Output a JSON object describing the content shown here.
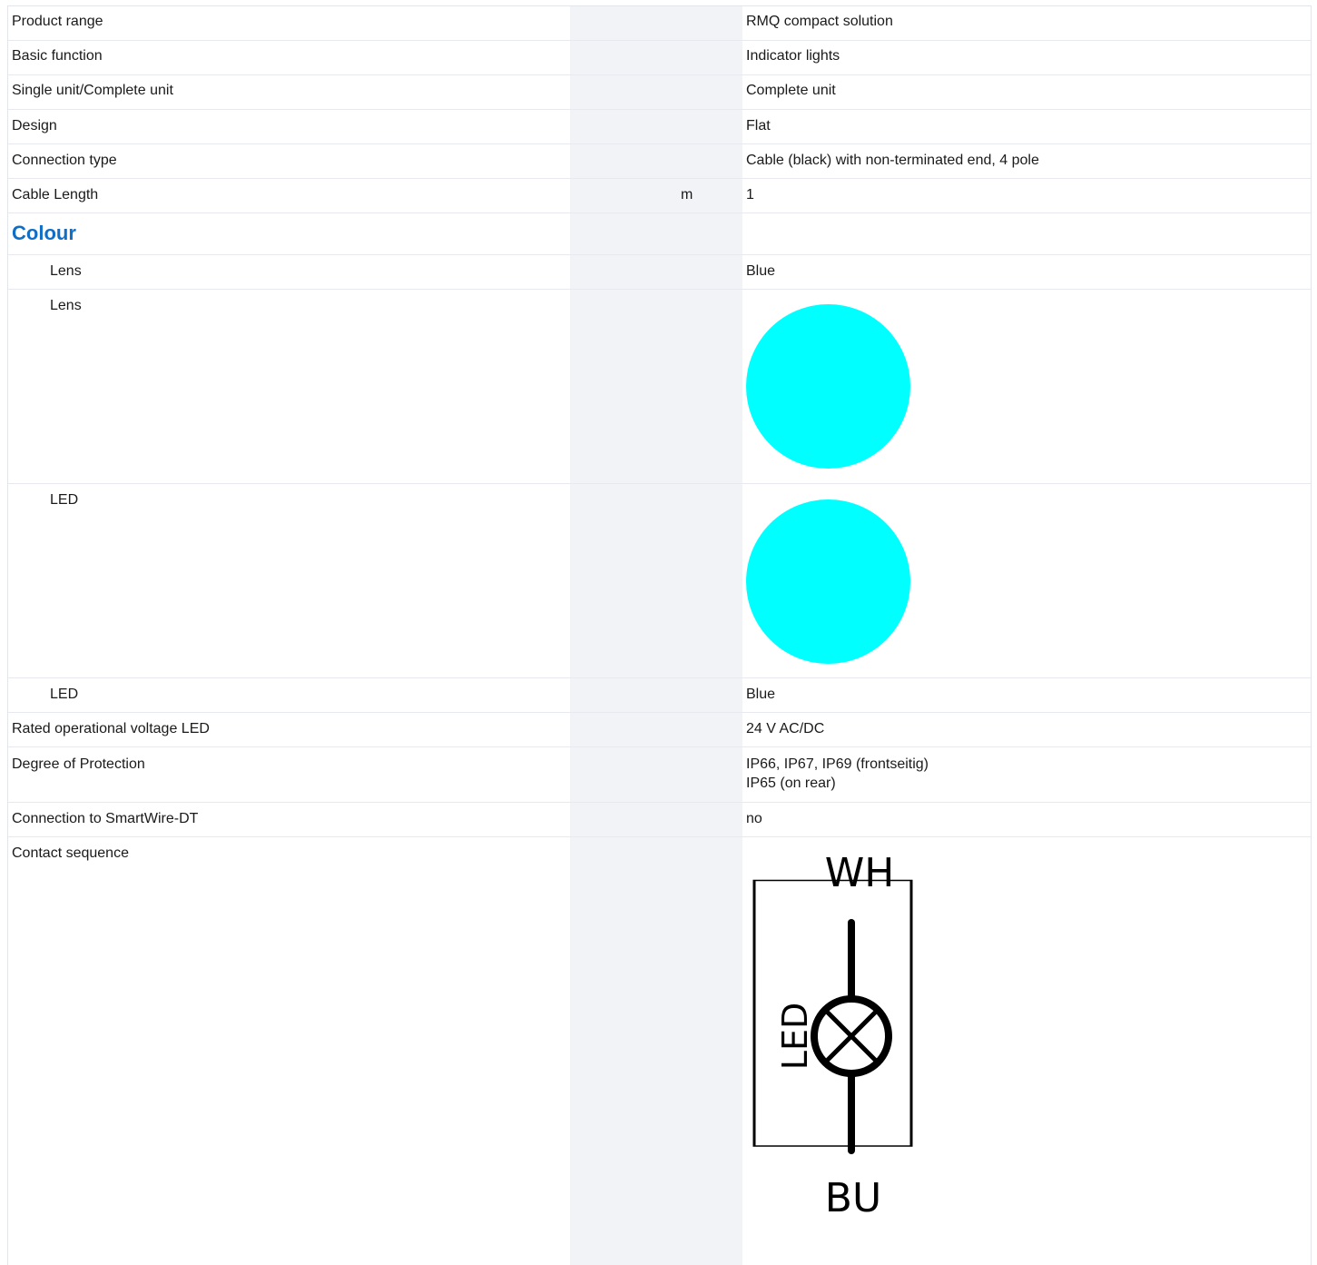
{
  "rows": [
    {
      "label": "Product range",
      "unit": "",
      "value": "RMQ compact solution"
    },
    {
      "label": "Basic function",
      "unit": "",
      "value": "Indicator lights"
    },
    {
      "label": "Single unit/Complete unit",
      "unit": "",
      "value": "Complete unit"
    },
    {
      "label": "Design",
      "unit": "",
      "value": "Flat"
    },
    {
      "label": "Connection type",
      "unit": "",
      "value": "Cable (black) with non-terminated end, 4 pole"
    },
    {
      "label": "Cable Length",
      "unit": "m",
      "value": "1"
    }
  ],
  "colour_group": {
    "heading": "Colour",
    "lens_text": {
      "label": "Lens",
      "value": "Blue"
    },
    "lens_swatch": {
      "label": "Lens",
      "color": "#00ffff"
    },
    "led_swatch": {
      "label": "LED",
      "color": "#00ffff"
    },
    "led_text": {
      "label": "LED",
      "value": "Blue"
    }
  },
  "rows2": [
    {
      "label": "Rated operational voltage LED",
      "value": "24 V AC/DC"
    },
    {
      "label": "Degree of Protection",
      "value_line1": "IP66, IP67, IP69 (frontseitig)",
      "value_line2": "IP65 (on rear)"
    },
    {
      "label": "Connection to SmartWire-DT",
      "value": "no"
    }
  ],
  "contact": {
    "label": "Contact sequence",
    "top_terminal": "WH",
    "bottom_terminal": "BU",
    "element_label": "LED"
  }
}
